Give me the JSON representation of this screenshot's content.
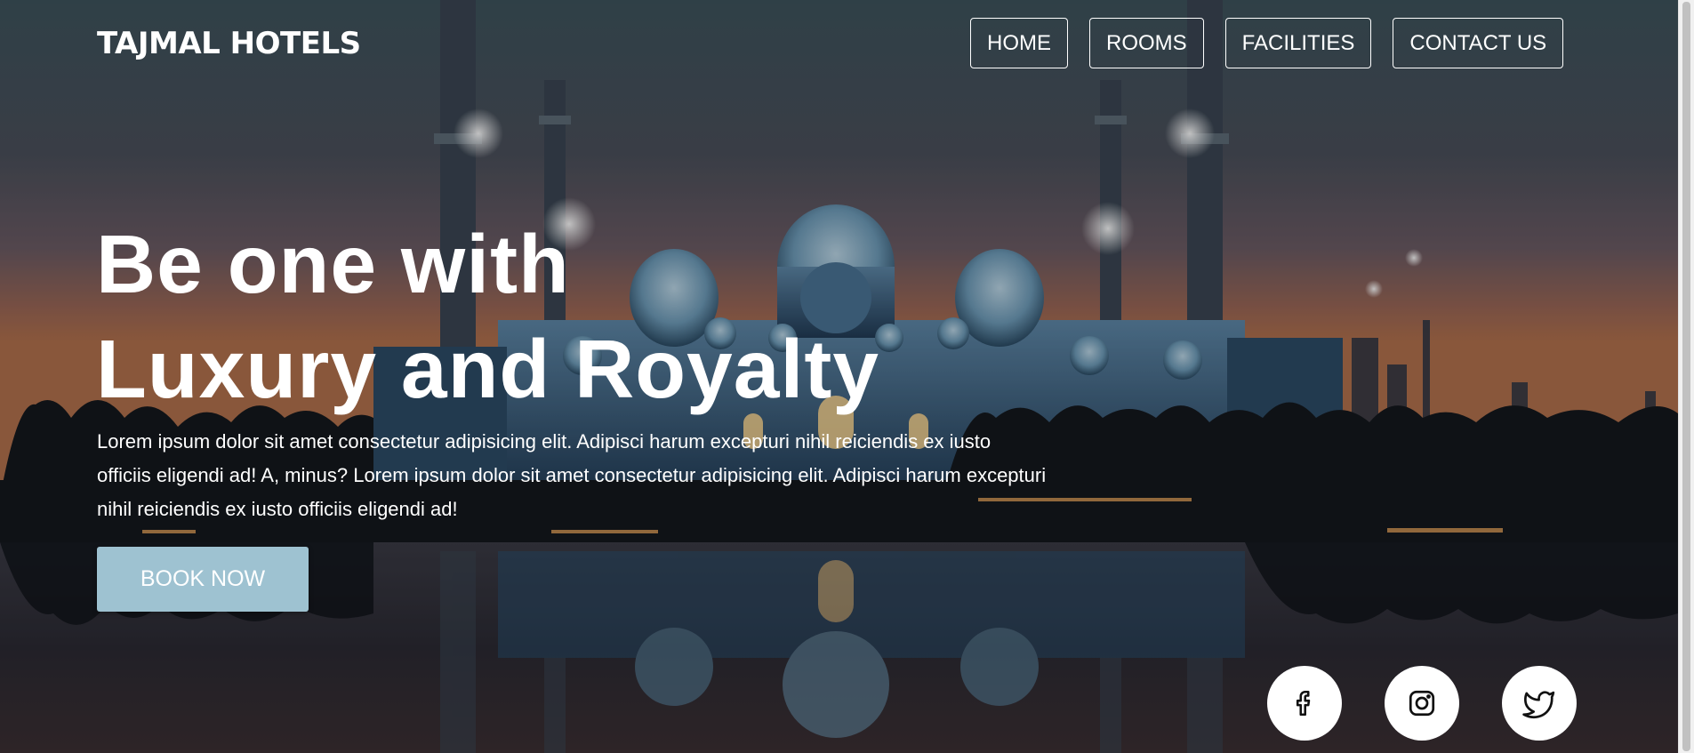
{
  "brand": {
    "logo_text": "TAJMAL HOTELS"
  },
  "nav": {
    "items": [
      {
        "label": "HOME"
      },
      {
        "label": "ROOMS"
      },
      {
        "label": "FACILITIES"
      },
      {
        "label": "CONTACT US"
      }
    ]
  },
  "hero": {
    "headline_line1": "Be one with",
    "headline_line2": "Luxury and Royalty",
    "description": "Lorem ipsum dolor sit amet consectetur adipisicing elit. Adipisci harum excepturi nihil reiciendis ex iusto officiis eligendi ad! A, minus? Lorem ipsum dolor sit amet consectetur adipisicing elit. Adipisci harum excepturi nihil reiciendis ex iusto officiis eligendi ad!",
    "cta_label": "BOOK NOW"
  },
  "social": [
    {
      "icon": "facebook-icon"
    },
    {
      "icon": "instagram-icon"
    },
    {
      "icon": "twitter-icon"
    }
  ],
  "colors": {
    "cta_background": "#9ec2d1",
    "text": "#ffffff",
    "sky_top": "#3a4f5a",
    "sky_bottom": "#a86a4e"
  }
}
